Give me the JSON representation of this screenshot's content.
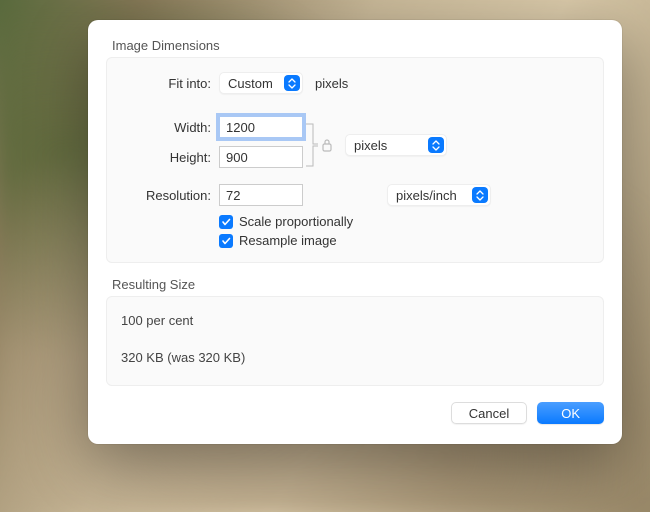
{
  "dimensions": {
    "group_label": "Image Dimensions",
    "fit_into_label": "Fit into:",
    "fit_into_value": "Custom",
    "fit_into_unit": "pixels",
    "width_label": "Width:",
    "width_value": "1200",
    "height_label": "Height:",
    "height_value": "900",
    "wh_unit_value": "pixels",
    "resolution_label": "Resolution:",
    "resolution_value": "72",
    "resolution_unit_value": "pixels/inch",
    "scale_label": "Scale proportionally",
    "scale_checked": true,
    "resample_label": "Resample image",
    "resample_checked": true
  },
  "resulting": {
    "group_label": "Resulting Size",
    "percent_line": "100 per cent",
    "size_line": "320 KB (was 320 KB)"
  },
  "footer": {
    "cancel": "Cancel",
    "ok": "OK"
  }
}
